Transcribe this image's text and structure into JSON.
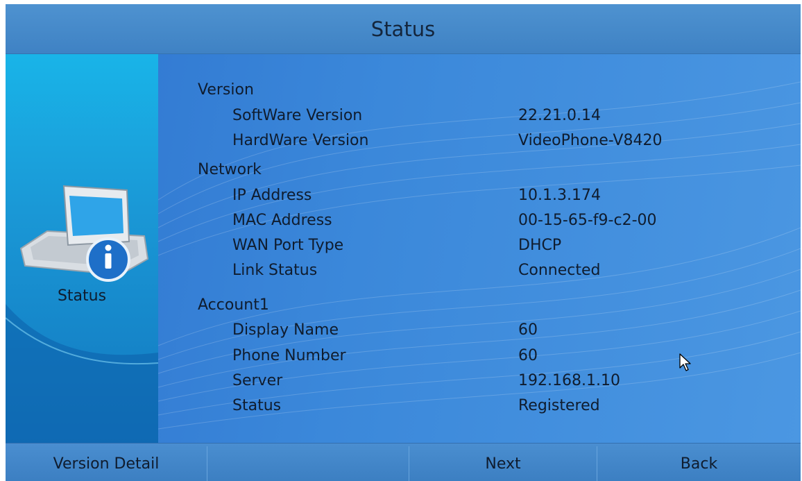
{
  "header": {
    "title": "Status"
  },
  "left_panel": {
    "label": "Status",
    "icon": "phone-info-icon"
  },
  "sections": [
    {
      "title": "Version",
      "rows": [
        {
          "label": "SoftWare Version",
          "value": "22.21.0.14"
        },
        {
          "label": "HardWare Version",
          "value": "VideoPhone-V8420"
        }
      ]
    },
    {
      "title": "Network",
      "rows": [
        {
          "label": "IP Address",
          "value": "10.1.3.174"
        },
        {
          "label": "MAC Address",
          "value": "00-15-65-f9-c2-00"
        },
        {
          "label": "WAN Port Type",
          "value": "DHCP"
        },
        {
          "label": "Link Status",
          "value": "Connected"
        }
      ]
    },
    {
      "title": "Account1",
      "rows": [
        {
          "label": "Display Name",
          "value": "60"
        },
        {
          "label": "Phone Number",
          "value": "60"
        },
        {
          "label": "Server",
          "value": "192.168.1.10"
        },
        {
          "label": "Status",
          "value": "Registered"
        }
      ]
    }
  ],
  "softkeys": [
    {
      "label": "Version Detail"
    },
    {
      "label": ""
    },
    {
      "label": "Next"
    },
    {
      "label": "Back"
    }
  ],
  "colors": {
    "background": "#3d8bd8",
    "text": "#0f1c2e",
    "panel": "#19b4e8"
  }
}
